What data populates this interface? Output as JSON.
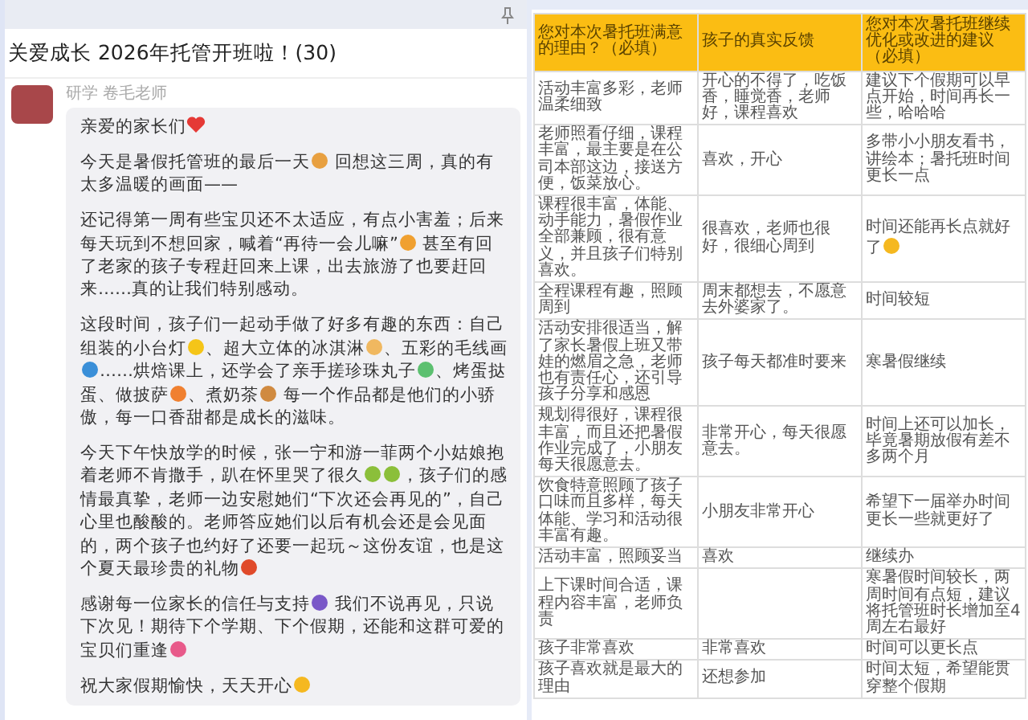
{
  "chat": {
    "title": "关爱成长 2026年托管开班啦！(30)",
    "sender": "研学 卷毛老师",
    "paragraphs": [
      [
        {
          "kind": "text",
          "text": "亲爱的家长们"
        },
        {
          "kind": "heart",
          "color": "#e53935"
        }
      ],
      [
        {
          "kind": "text",
          "text": "今天是暑假托管班的最后一天"
        },
        {
          "kind": "emoji",
          "color": "#e8a040"
        },
        {
          "kind": "text",
          "text": " 回想这三周，真的有太多温暖的画面——"
        }
      ],
      [
        {
          "kind": "text",
          "text": "还记得第一周有些宝贝还不太适应，有点小害羞；后来每天玩到不想回家，喊着“再待一会儿嘛”"
        },
        {
          "kind": "emoji",
          "color": "#f0a030"
        },
        {
          "kind": "text",
          "text": " 甚至有回了老家的孩子专程赶回来上课，出去旅游了也要赶回来……真的让我们特别感动。"
        }
      ],
      [
        {
          "kind": "text",
          "text": "这段时间，孩子们一起动手做了好多有趣的东西：自己组装的小台灯"
        },
        {
          "kind": "emoji",
          "color": "#f5c518"
        },
        {
          "kind": "text",
          "text": "、超大立体的冰淇淋"
        },
        {
          "kind": "emoji",
          "color": "#f0b860"
        },
        {
          "kind": "text",
          "text": "、五彩的毛线画"
        },
        {
          "kind": "emoji",
          "color": "#3a8fd8"
        },
        {
          "kind": "text",
          "text": "……烘焙课上，还学会了亲手搓珍珠丸子"
        },
        {
          "kind": "emoji",
          "color": "#5cc070"
        },
        {
          "kind": "text",
          "text": "、烤蛋挞蛋、做披萨"
        },
        {
          "kind": "emoji",
          "color": "#f08030"
        },
        {
          "kind": "text",
          "text": "、煮奶茶"
        },
        {
          "kind": "emoji",
          "color": "#d08a40"
        },
        {
          "kind": "text",
          "text": " 每一个作品都是他们的小骄傲，每一口香甜都是成长的滋味。"
        }
      ],
      [
        {
          "kind": "text",
          "text": "今天下午快放学的时候，张一宁和游一菲两个小姑娘抱着老师不肯撒手，趴在怀里哭了很久"
        },
        {
          "kind": "emoji",
          "color": "#8bbf3a"
        },
        {
          "kind": "emoji",
          "color": "#8bbf3a"
        },
        {
          "kind": "text",
          "text": "，孩子们的感情最真挚，老师一边安慰她们“下次还会再见的”，自己心里也酸酸的。老师答应她们以后有机会还是会见面的，两个孩子也约好了还要一起玩～这份友谊，也是这个夏天最珍贵的礼物"
        },
        {
          "kind": "emoji",
          "color": "#e04a2a"
        }
      ],
      [
        {
          "kind": "text",
          "text": "感谢每一位家长的信任与支持"
        },
        {
          "kind": "emoji",
          "color": "#7a58c8"
        },
        {
          "kind": "text",
          "text": " 我们不说再见，只说下次见！期待下个学期、下个假期，还能和这群可爱的宝贝们重逢"
        },
        {
          "kind": "emoji",
          "color": "#e85a8a"
        }
      ],
      [
        {
          "kind": "text",
          "text": "祝大家假期愉快，天天开心"
        },
        {
          "kind": "emoji",
          "color": "#f5b820"
        }
      ]
    ]
  },
  "table": {
    "columns": [
      "您对本次暑托班满意的理由？（必填）",
      "孩子的真实反馈",
      "您对本次暑托班继续优化或改进的建议（必填）"
    ],
    "rows": [
      [
        {
          "text": "活动丰富多彩，老师温柔细致"
        },
        {
          "text": "开心的不得了，吃饭香，睡觉香，老师好，课程喜欢"
        },
        {
          "text": "建议下个假期可以早点开始，时间再长一些，哈哈哈"
        }
      ],
      [
        {
          "text": "老师照看仔细，课程丰富，最主要是在公司本部这边，接送方便，饭菜放心。"
        },
        {
          "text": "喜欢，开心"
        },
        {
          "text": "多带小小朋友看书，讲绘本；暑托班时间更长一点"
        }
      ],
      [
        {
          "text": "课程很丰富，体能、动手能力，暑假作业全部兼顾，很有意义，并且孩子们特别喜欢。"
        },
        {
          "text": "很喜欢，老师也很好，很细心周到"
        },
        {
          "text": "时间还能再长点就好了",
          "color": "#f5b820"
        }
      ],
      [
        {
          "text": "全程课程有趣，照顾周到"
        },
        {
          "text": "周末都想去，不愿意去外婆家了。"
        },
        {
          "text": "时间较短"
        }
      ],
      [
        {
          "text": "活动安排很适当，解了家长暑假上班又带娃的燃眉之急，老师也有责任心，还引导孩子分享和感恩"
        },
        {
          "text": "孩子每天都准时要来"
        },
        {
          "text": "寒暑假继续"
        }
      ],
      [
        {
          "text": "规划得很好，课程很丰富，而且还把暑假作业完成了，小朋友每天很愿意去。"
        },
        {
          "text": "非常开心，每天很愿意去。"
        },
        {
          "text": "时间上还可以加长，毕竟暑期放假有差不多两个月"
        }
      ],
      [
        {
          "text": "饮食特意照顾了孩子口味而且多样，每天体能、学习和活动很丰富有趣。"
        },
        {
          "text": "小朋友非常开心"
        },
        {
          "text": "希望下一届举办时间更长一些就更好了"
        }
      ],
      [
        {
          "text": "活动丰富，照顾妥当"
        },
        {
          "text": "喜欢"
        },
        {
          "text": "继续办"
        }
      ],
      [
        {
          "text": "上下课时间合适，课程内容丰富，老师负责"
        },
        {},
        {
          "text": "寒暑假时间较长，两周时间有点短，建议将托管班时长增加至4周左右最好"
        }
      ],
      [
        {
          "text": "孩子非常喜欢"
        },
        {
          "text": "非常喜欢"
        },
        {
          "text": "时间可以更长点"
        }
      ],
      [
        {
          "text": "孩子喜欢就是最大的理由"
        },
        {
          "text": "还想参加"
        },
        {
          "text": "时间太短，希望能贯穿整个假期"
        }
      ]
    ]
  }
}
